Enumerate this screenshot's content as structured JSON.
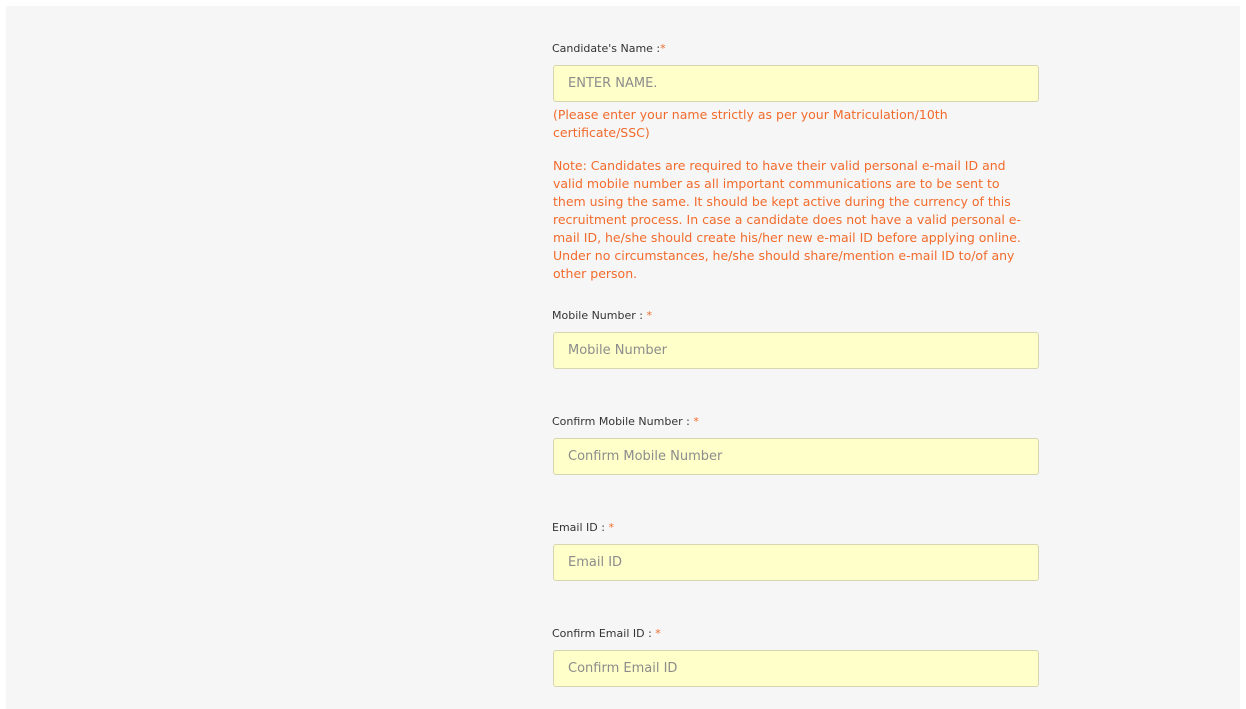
{
  "form": {
    "candidate_name": {
      "label": "Candidate's Name :",
      "required_mark": "*",
      "placeholder": "ENTER NAME.",
      "value": "",
      "hint": "(Please enter your name strictly as per your Matriculation/10th certificate/SSC)"
    },
    "note": "Note: Candidates are required to have their valid personal e-mail ID and valid mobile number as all important communications are to be sent to them using the same. It should be kept active during the currency of this recruitment process. In case a candidate does not have a valid personal e-mail ID, he/she should create his/her new e-mail ID before applying online. Under no circumstances, he/she should share/mention e-mail ID to/of any other person.",
    "mobile": {
      "label": "Mobile Number :",
      "required_mark": "*",
      "placeholder": "Mobile Number",
      "value": ""
    },
    "confirm_mobile": {
      "label": "Confirm Mobile Number :",
      "required_mark": "*",
      "placeholder": "Confirm Mobile Number",
      "value": ""
    },
    "email": {
      "label": "Email ID :",
      "required_mark": "*",
      "placeholder": "Email ID",
      "value": ""
    },
    "confirm_email": {
      "label": "Confirm Email ID :",
      "required_mark": "*",
      "placeholder": "Confirm Email ID",
      "value": ""
    }
  },
  "colors": {
    "page_background": "#f6f6f6",
    "input_background": "#ffffc9",
    "accent_orange": "#f26b2c",
    "label_text": "#333333",
    "placeholder_text": "#8c8c8c"
  }
}
